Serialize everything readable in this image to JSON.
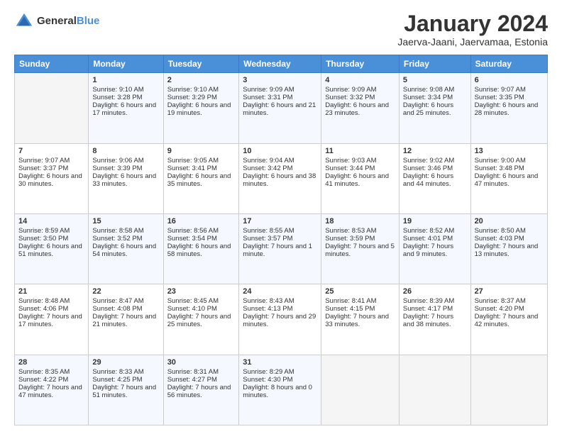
{
  "header": {
    "logo_general": "General",
    "logo_blue": "Blue",
    "title": "January 2024",
    "subtitle": "Jaerva-Jaani, Jaervamaa, Estonia"
  },
  "columns": [
    "Sunday",
    "Monday",
    "Tuesday",
    "Wednesday",
    "Thursday",
    "Friday",
    "Saturday"
  ],
  "weeks": [
    [
      {
        "day": "",
        "sunrise": "",
        "sunset": "",
        "daylight": ""
      },
      {
        "day": "1",
        "sunrise": "Sunrise: 9:10 AM",
        "sunset": "Sunset: 3:28 PM",
        "daylight": "Daylight: 6 hours and 17 minutes."
      },
      {
        "day": "2",
        "sunrise": "Sunrise: 9:10 AM",
        "sunset": "Sunset: 3:29 PM",
        "daylight": "Daylight: 6 hours and 19 minutes."
      },
      {
        "day": "3",
        "sunrise": "Sunrise: 9:09 AM",
        "sunset": "Sunset: 3:31 PM",
        "daylight": "Daylight: 6 hours and 21 minutes."
      },
      {
        "day": "4",
        "sunrise": "Sunrise: 9:09 AM",
        "sunset": "Sunset: 3:32 PM",
        "daylight": "Daylight: 6 hours and 23 minutes."
      },
      {
        "day": "5",
        "sunrise": "Sunrise: 9:08 AM",
        "sunset": "Sunset: 3:34 PM",
        "daylight": "Daylight: 6 hours and 25 minutes."
      },
      {
        "day": "6",
        "sunrise": "Sunrise: 9:07 AM",
        "sunset": "Sunset: 3:35 PM",
        "daylight": "Daylight: 6 hours and 28 minutes."
      }
    ],
    [
      {
        "day": "7",
        "sunrise": "Sunrise: 9:07 AM",
        "sunset": "Sunset: 3:37 PM",
        "daylight": "Daylight: 6 hours and 30 minutes."
      },
      {
        "day": "8",
        "sunrise": "Sunrise: 9:06 AM",
        "sunset": "Sunset: 3:39 PM",
        "daylight": "Daylight: 6 hours and 33 minutes."
      },
      {
        "day": "9",
        "sunrise": "Sunrise: 9:05 AM",
        "sunset": "Sunset: 3:41 PM",
        "daylight": "Daylight: 6 hours and 35 minutes."
      },
      {
        "day": "10",
        "sunrise": "Sunrise: 9:04 AM",
        "sunset": "Sunset: 3:42 PM",
        "daylight": "Daylight: 6 hours and 38 minutes."
      },
      {
        "day": "11",
        "sunrise": "Sunrise: 9:03 AM",
        "sunset": "Sunset: 3:44 PM",
        "daylight": "Daylight: 6 hours and 41 minutes."
      },
      {
        "day": "12",
        "sunrise": "Sunrise: 9:02 AM",
        "sunset": "Sunset: 3:46 PM",
        "daylight": "Daylight: 6 hours and 44 minutes."
      },
      {
        "day": "13",
        "sunrise": "Sunrise: 9:00 AM",
        "sunset": "Sunset: 3:48 PM",
        "daylight": "Daylight: 6 hours and 47 minutes."
      }
    ],
    [
      {
        "day": "14",
        "sunrise": "Sunrise: 8:59 AM",
        "sunset": "Sunset: 3:50 PM",
        "daylight": "Daylight: 6 hours and 51 minutes."
      },
      {
        "day": "15",
        "sunrise": "Sunrise: 8:58 AM",
        "sunset": "Sunset: 3:52 PM",
        "daylight": "Daylight: 6 hours and 54 minutes."
      },
      {
        "day": "16",
        "sunrise": "Sunrise: 8:56 AM",
        "sunset": "Sunset: 3:54 PM",
        "daylight": "Daylight: 6 hours and 58 minutes."
      },
      {
        "day": "17",
        "sunrise": "Sunrise: 8:55 AM",
        "sunset": "Sunset: 3:57 PM",
        "daylight": "Daylight: 7 hours and 1 minute."
      },
      {
        "day": "18",
        "sunrise": "Sunrise: 8:53 AM",
        "sunset": "Sunset: 3:59 PM",
        "daylight": "Daylight: 7 hours and 5 minutes."
      },
      {
        "day": "19",
        "sunrise": "Sunrise: 8:52 AM",
        "sunset": "Sunset: 4:01 PM",
        "daylight": "Daylight: 7 hours and 9 minutes."
      },
      {
        "day": "20",
        "sunrise": "Sunrise: 8:50 AM",
        "sunset": "Sunset: 4:03 PM",
        "daylight": "Daylight: 7 hours and 13 minutes."
      }
    ],
    [
      {
        "day": "21",
        "sunrise": "Sunrise: 8:48 AM",
        "sunset": "Sunset: 4:06 PM",
        "daylight": "Daylight: 7 hours and 17 minutes."
      },
      {
        "day": "22",
        "sunrise": "Sunrise: 8:47 AM",
        "sunset": "Sunset: 4:08 PM",
        "daylight": "Daylight: 7 hours and 21 minutes."
      },
      {
        "day": "23",
        "sunrise": "Sunrise: 8:45 AM",
        "sunset": "Sunset: 4:10 PM",
        "daylight": "Daylight: 7 hours and 25 minutes."
      },
      {
        "day": "24",
        "sunrise": "Sunrise: 8:43 AM",
        "sunset": "Sunset: 4:13 PM",
        "daylight": "Daylight: 7 hours and 29 minutes."
      },
      {
        "day": "25",
        "sunrise": "Sunrise: 8:41 AM",
        "sunset": "Sunset: 4:15 PM",
        "daylight": "Daylight: 7 hours and 33 minutes."
      },
      {
        "day": "26",
        "sunrise": "Sunrise: 8:39 AM",
        "sunset": "Sunset: 4:17 PM",
        "daylight": "Daylight: 7 hours and 38 minutes."
      },
      {
        "day": "27",
        "sunrise": "Sunrise: 8:37 AM",
        "sunset": "Sunset: 4:20 PM",
        "daylight": "Daylight: 7 hours and 42 minutes."
      }
    ],
    [
      {
        "day": "28",
        "sunrise": "Sunrise: 8:35 AM",
        "sunset": "Sunset: 4:22 PM",
        "daylight": "Daylight: 7 hours and 47 minutes."
      },
      {
        "day": "29",
        "sunrise": "Sunrise: 8:33 AM",
        "sunset": "Sunset: 4:25 PM",
        "daylight": "Daylight: 7 hours and 51 minutes."
      },
      {
        "day": "30",
        "sunrise": "Sunrise: 8:31 AM",
        "sunset": "Sunset: 4:27 PM",
        "daylight": "Daylight: 7 hours and 56 minutes."
      },
      {
        "day": "31",
        "sunrise": "Sunrise: 8:29 AM",
        "sunset": "Sunset: 4:30 PM",
        "daylight": "Daylight: 8 hours and 0 minutes."
      },
      {
        "day": "",
        "sunrise": "",
        "sunset": "",
        "daylight": ""
      },
      {
        "day": "",
        "sunrise": "",
        "sunset": "",
        "daylight": ""
      },
      {
        "day": "",
        "sunrise": "",
        "sunset": "",
        "daylight": ""
      }
    ]
  ]
}
